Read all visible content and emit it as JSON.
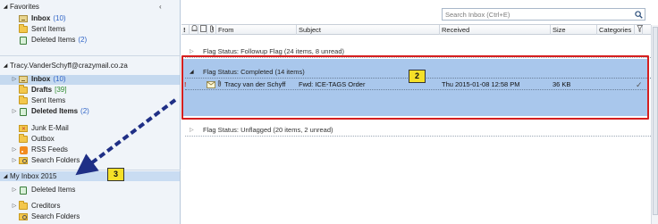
{
  "nav": {
    "favorites_header": "Favorites",
    "favorites": [
      {
        "label": "Inbox",
        "count": "(10)",
        "bold": true
      },
      {
        "label": "Sent Items",
        "count": ""
      },
      {
        "label": "Deleted Items",
        "count": "(2)"
      }
    ],
    "account_header": "Tracy.VanderSchyff@crazymail.co.za",
    "account_items": [
      {
        "label": "Inbox",
        "count": "(10)",
        "bold": true
      },
      {
        "label": "Drafts",
        "count": "[39]",
        "bold": true
      },
      {
        "label": "Sent Items",
        "count": ""
      },
      {
        "label": "Deleted Items",
        "count": "(2)",
        "bold": true
      },
      {
        "label": "Junk E-Mail",
        "count": ""
      },
      {
        "label": "Outbox",
        "count": ""
      },
      {
        "label": "RSS Feeds",
        "count": ""
      },
      {
        "label": "Search Folders",
        "count": ""
      }
    ],
    "second_header": "My Inbox 2015",
    "second_items": [
      {
        "label": "Deleted Items",
        "count": ""
      },
      {
        "label": "Creditors",
        "count": ""
      },
      {
        "label": "Search Folders",
        "count": ""
      }
    ]
  },
  "search": {
    "placeholder": "Search Inbox (Ctrl+E)"
  },
  "columns": {
    "from": "From",
    "subject": "Subject",
    "received": "Received",
    "size": "Size",
    "categories": "Categories"
  },
  "groups": [
    {
      "label": "Flag Status: Followup Flag (24 items, 8 unread)"
    },
    {
      "label": "Flag Status: Completed (14 items)"
    },
    {
      "label": "Flag Status: Unflagged (20 items, 2 unread)"
    }
  ],
  "message": {
    "importance": "!",
    "from": "Tracy van der Schyff",
    "subject": "Fwd: ICE-TAGS Order",
    "received": "Thu 2015-01-08 12:58 PM",
    "size": "36 KB",
    "flag": "✓"
  },
  "callouts": {
    "badge_2": "2",
    "badge_3": "3"
  },
  "colors": {
    "selection": "#a9c7ec",
    "callout_border": "#d51f1f",
    "callout_badge": "#f5e028",
    "arrow": "#1f2f86",
    "count_blue": "#2f64c7",
    "count_green": "#2e8b2e"
  }
}
